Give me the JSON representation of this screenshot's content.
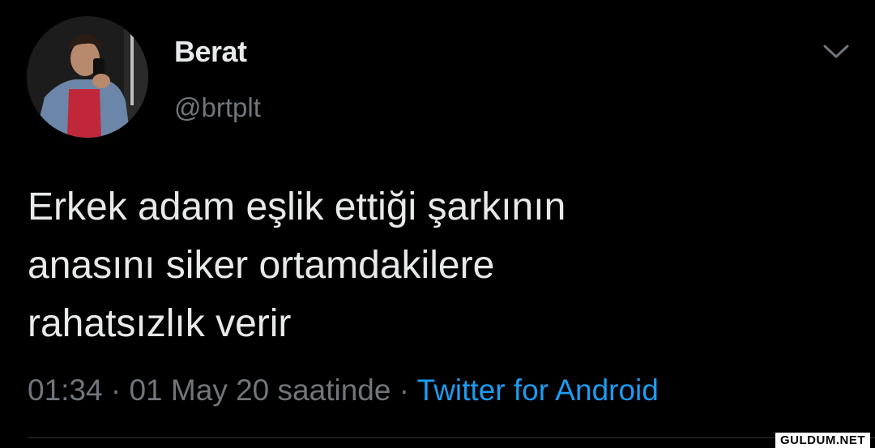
{
  "tweet": {
    "author_name": "Berat",
    "author_handle": "@brtplt",
    "text_lines": [
      "Erkek adam eşlik ettiği şarkının",
      "anasını siker ortamdakilere",
      "rahatsızlık verir"
    ],
    "time": "01:34",
    "separator": "·",
    "date": "01 May 20 saatinde",
    "source": "Twitter for Android",
    "menu_icon": "chevron-down-icon"
  },
  "watermark": "GULDUM.NET",
  "colors": {
    "background": "#000000",
    "primary_text": "#e7e9ea",
    "secondary_text": "#71767b",
    "link": "#1d9bf0"
  }
}
